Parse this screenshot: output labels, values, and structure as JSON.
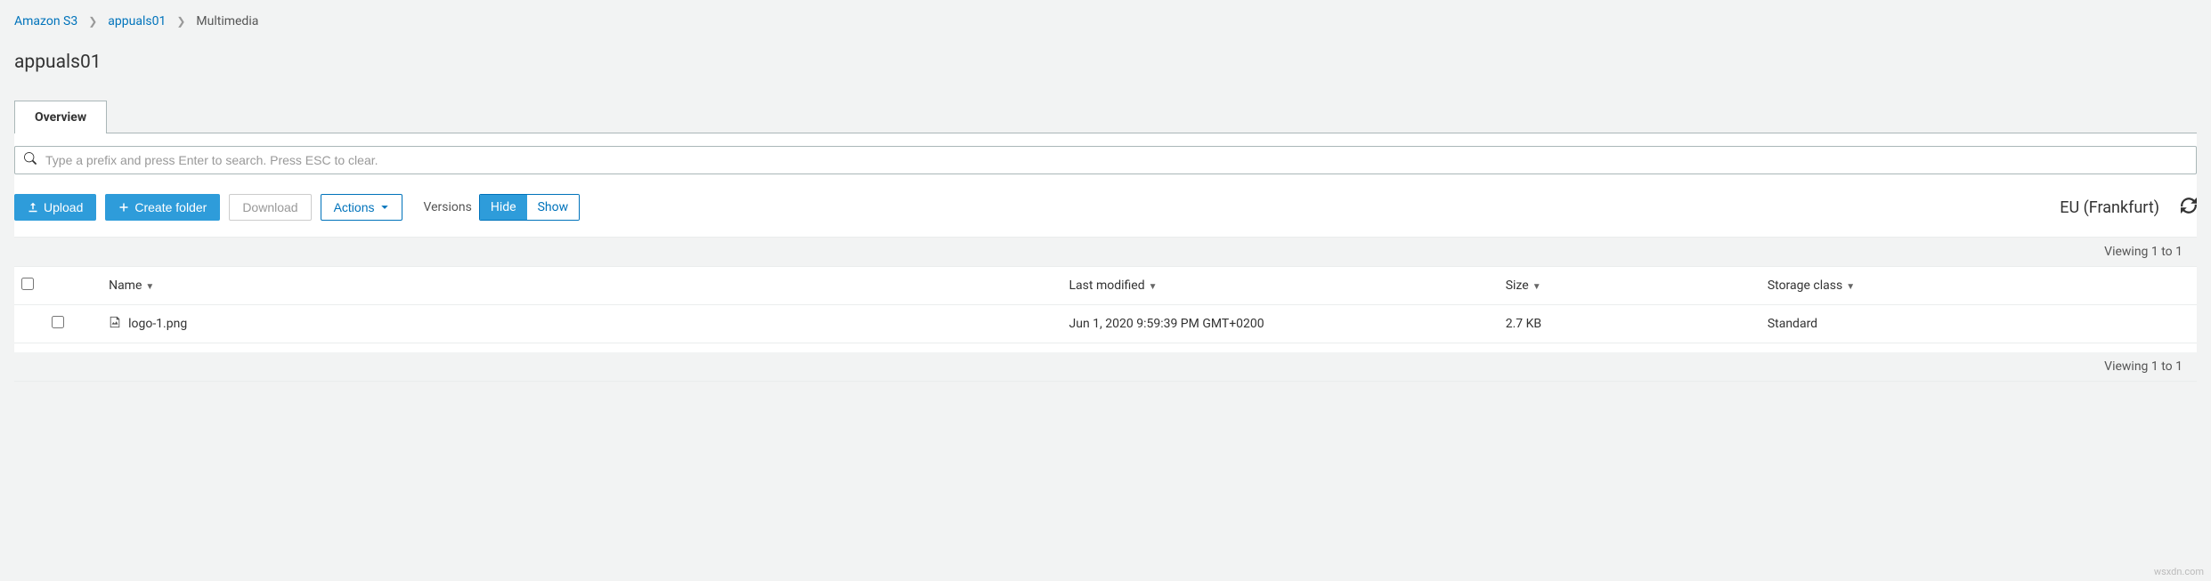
{
  "breadcrumb": {
    "root": "Amazon S3",
    "bucket": "appuals01",
    "current": "Multimedia"
  },
  "title": "appuals01",
  "tabs": {
    "overview": "Overview"
  },
  "search": {
    "placeholder": "Type a prefix and press Enter to search. Press ESC to clear."
  },
  "toolbar": {
    "upload": "Upload",
    "create_folder": "Create folder",
    "download": "Download",
    "actions": "Actions"
  },
  "versions": {
    "label": "Versions",
    "hide": "Hide",
    "show": "Show"
  },
  "region": "EU (Frankfurt)",
  "viewing": "Viewing 1 to 1",
  "columns": {
    "name": "Name",
    "last_modified": "Last modified",
    "size": "Size",
    "storage_class": "Storage class"
  },
  "rows": [
    {
      "name": "logo-1.png",
      "last_modified": "Jun 1, 2020 9:59:39 PM GMT+0200",
      "size": "2.7 KB",
      "storage_class": "Standard"
    }
  ],
  "watermark": "wsxdn.com"
}
